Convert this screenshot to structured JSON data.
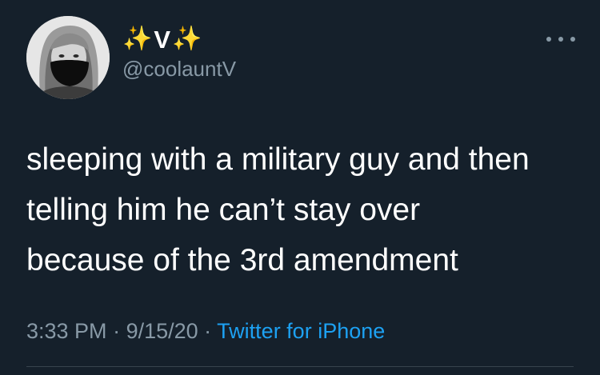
{
  "user": {
    "sparkle_left": "✨",
    "display_name": "V",
    "sparkle_right": "✨",
    "handle": "@coolauntV",
    "avatar_icon": "profile-photo-masked"
  },
  "tweet": {
    "lines": [
      "sleeping with a military guy and then",
      "telling him he can’t stay over",
      "because of the 3rd amendment"
    ]
  },
  "meta": {
    "time": "3:33 PM",
    "separator1": " · ",
    "date": "9/15/20",
    "separator2": " · ",
    "source": "Twitter for iPhone"
  },
  "colors": {
    "background": "#15202b",
    "text": "#ffffff",
    "secondary": "#8899a6",
    "link": "#1da1f2",
    "sparkle": "#f7c948"
  }
}
